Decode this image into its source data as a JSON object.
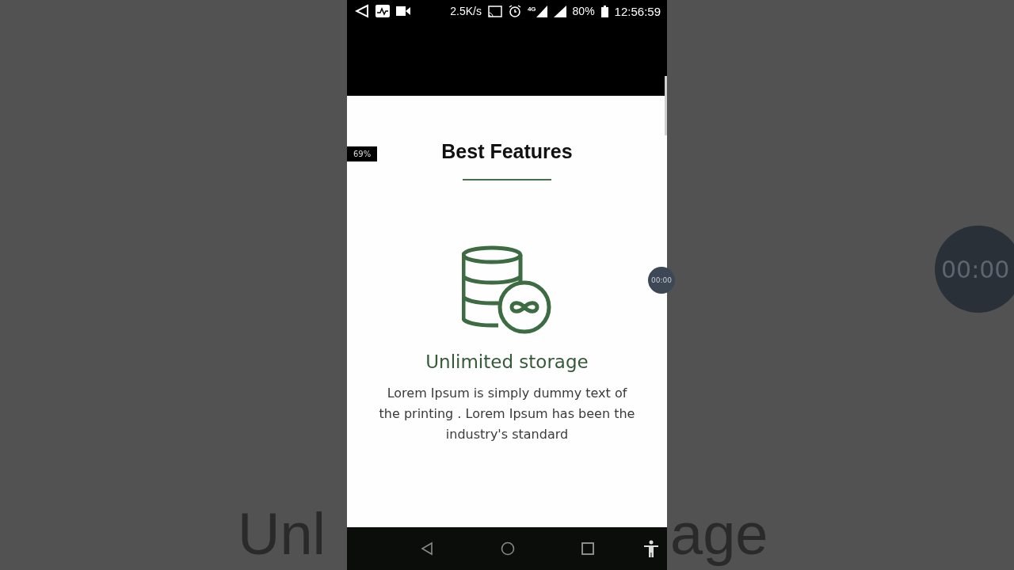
{
  "backdrop": {
    "left_caption": "Unl",
    "right_caption": "age",
    "timer": "00:00"
  },
  "status_bar": {
    "speed": "2.5K/s",
    "network": "4G",
    "battery": "80%",
    "time": "12:56:59"
  },
  "zoom_badge": "69%",
  "section": {
    "title": "Best Features"
  },
  "feature": {
    "title": "Unlimited storage",
    "description": "Lorem Ipsum is simply dummy text of the printing . Lorem Ipsum has been the industry's standard"
  },
  "floating_timer": "00:00"
}
